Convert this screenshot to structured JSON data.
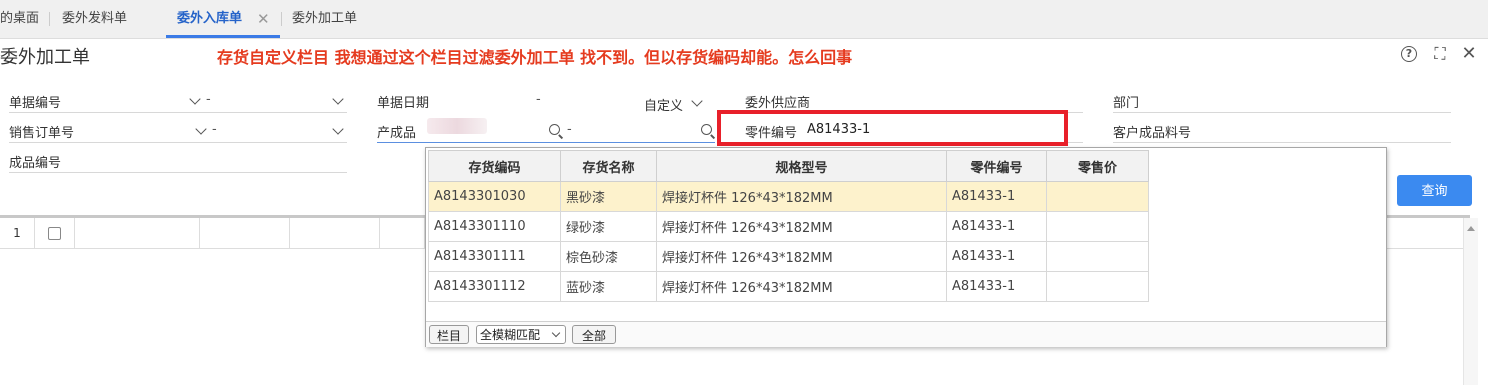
{
  "tabs": [
    {
      "label": "的桌面"
    },
    {
      "label": "委外发料单"
    },
    {
      "label": "委外入库单"
    },
    {
      "label": "委外加工单"
    }
  ],
  "tab_close": "✕",
  "page_title": "委外加工单",
  "annotation": "存货自定义栏目  我想通过这个栏目过滤委外加工单 找不到。但以存货编码却能。怎么回事",
  "window_icons": {
    "help": "?",
    "maximize": "⛶",
    "close": "✕"
  },
  "filters": {
    "doc_no": {
      "label": "单据编号",
      "value": "-"
    },
    "sales_order_no": {
      "label": "销售订单号",
      "value": "-"
    },
    "product_no": {
      "label": "成品编号"
    },
    "doc_date": {
      "label": "单据日期",
      "value": "-",
      "mode": "自定义"
    },
    "product": {
      "label": "产成品",
      "value": "-"
    },
    "supplier": {
      "label": "委外供应商"
    },
    "part_no": {
      "label": "零件编号",
      "value": "A81433-1"
    },
    "department": {
      "label": "部门"
    },
    "customer_part_no": {
      "label": "客户成品料号"
    }
  },
  "query_button": "查询",
  "grid": {
    "row_number": "1"
  },
  "popup": {
    "columns": [
      "存货编码",
      "存货名称",
      "规格型号",
      "零件编号",
      "零售价"
    ],
    "rows": [
      {
        "code": "A8143301030",
        "name": "黑砂漆",
        "spec": "焊接灯杯件 126*43*182MM",
        "part": "A81433-1",
        "price": ""
      },
      {
        "code": "A8143301110",
        "name": "绿砂漆",
        "spec": "焊接灯杯件 126*43*182MM",
        "part": "A81433-1",
        "price": ""
      },
      {
        "code": "A8143301111",
        "name": "棕色砂漆",
        "spec": "焊接灯杯件 126*43*182MM",
        "part": "A81433-1",
        "price": ""
      },
      {
        "code": "A8143301112",
        "name": "蓝砂漆",
        "spec": "焊接灯杯件 126*43*182MM",
        "part": "A81433-1",
        "price": ""
      }
    ],
    "footer": {
      "columns_button": "栏目",
      "match_mode": "全模糊匹配",
      "all_button": "全部"
    }
  },
  "colors": {
    "accent": "#3b8af0",
    "annotation": "#e53b1f",
    "highlight_box": "#e8202a",
    "selected_row": "#fdf2cc"
  }
}
